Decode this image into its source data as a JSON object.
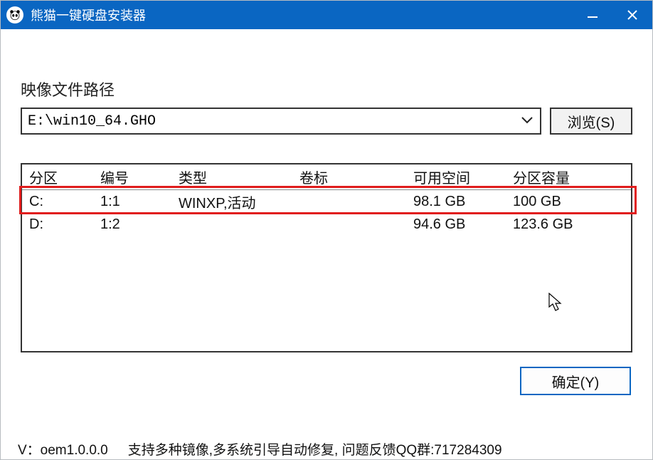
{
  "titlebar": {
    "app_title": "熊猫一键硬盘安装器"
  },
  "path": {
    "label": "映像文件路径",
    "value": "E:\\win10_64.GHO",
    "browse_label": "浏览(S)"
  },
  "table": {
    "headers": {
      "partition": "分区",
      "index": "编号",
      "type": "类型",
      "volume": "卷标",
      "free": "可用空间",
      "capacity": "分区容量"
    },
    "rows": [
      {
        "partition": "C:",
        "index": "1:1",
        "type": "WINXP,活动",
        "volume": "",
        "free": "98.1 GB",
        "capacity": "100 GB"
      },
      {
        "partition": "D:",
        "index": "1:2",
        "type": "",
        "volume": "",
        "free": "94.6 GB",
        "capacity": "123.6 GB"
      }
    ]
  },
  "ok_label": "确定(Y)",
  "footer": {
    "version": "V：oem1.0.0.0",
    "note": "支持多种镜像,多系统引导自动修复, 问题反馈QQ群:717284309"
  }
}
